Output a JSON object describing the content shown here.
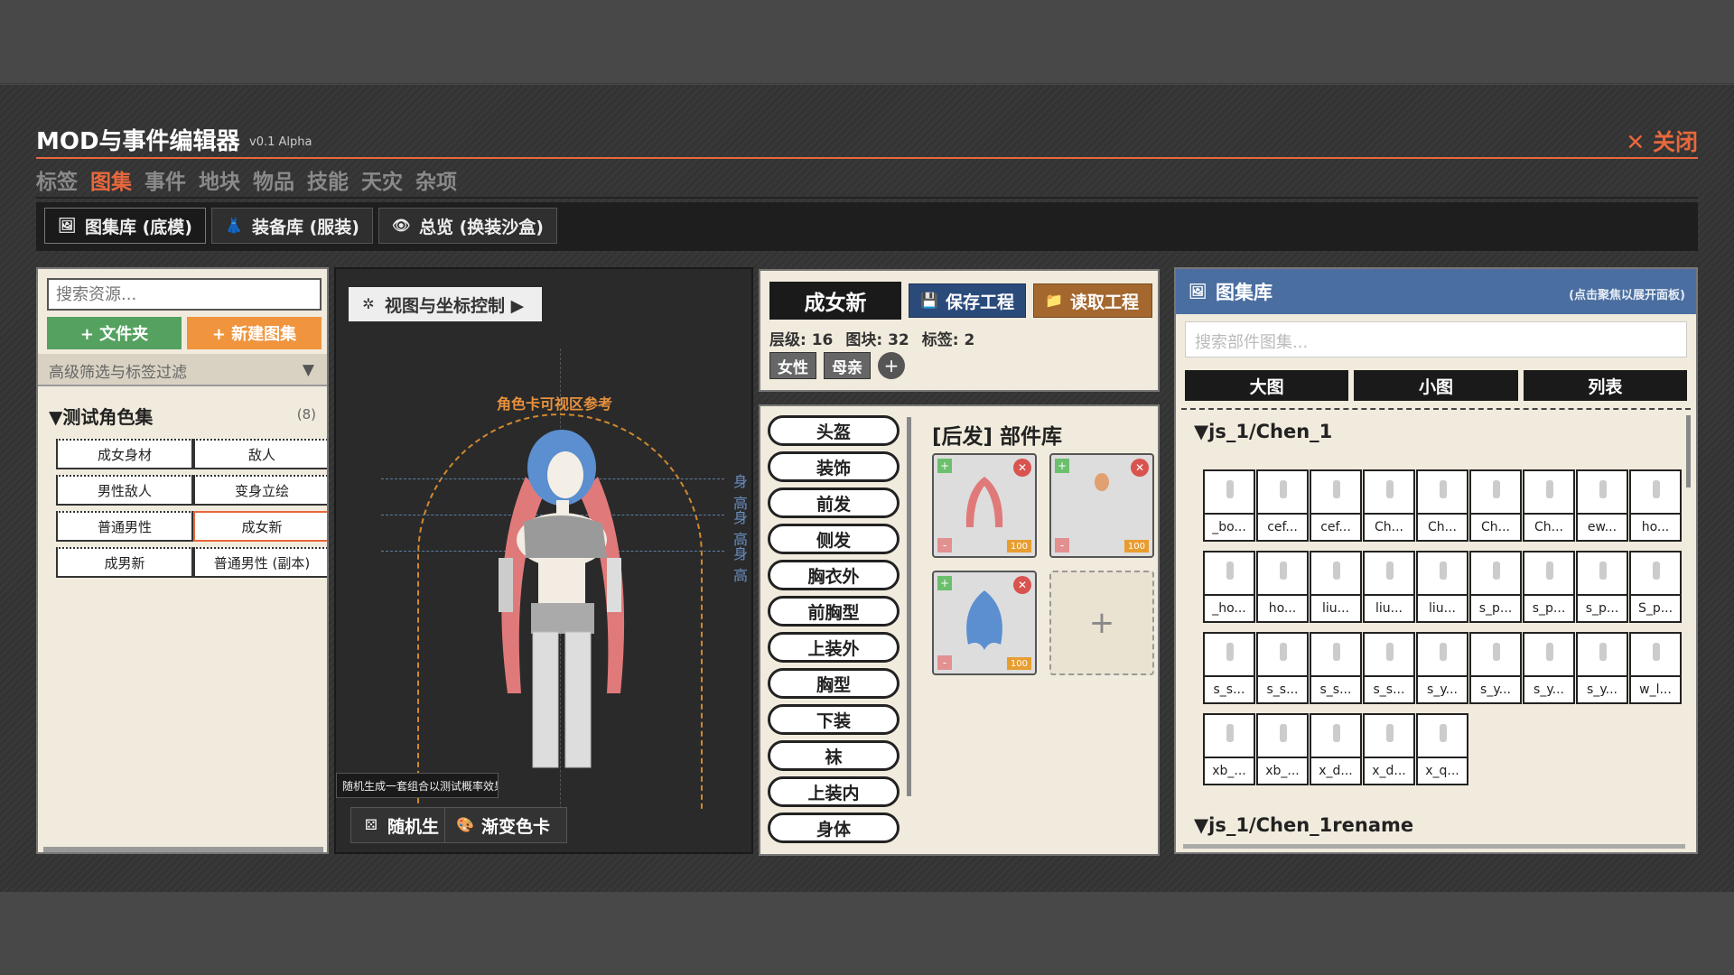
{
  "app": {
    "title": "MOD与事件编辑器",
    "version": "v0.1 Alpha",
    "close_label": "✕ 关闭"
  },
  "nav": [
    "标签",
    "图集",
    "事件",
    "地块",
    "物品",
    "技能",
    "天灾",
    "杂项"
  ],
  "subtabs": [
    {
      "label": "图集库 (底模)",
      "icon": "🖼"
    },
    {
      "label": "装备库 (服装)",
      "icon": "👗"
    },
    {
      "label": "总览 (换装沙盒)",
      "icon": "👁"
    }
  ],
  "left_panel": {
    "search_placeholder": "搜索资源...",
    "folder_btn": "+ 文件夹",
    "new_atlas_btn": "+ 新建图集",
    "filter_label": "高级筛选与标签过滤",
    "filter_arrow": "▼",
    "group_name": "▼测试角色集",
    "group_count": "(8)",
    "items": [
      "成女身材",
      "敌人",
      "男性敌人",
      "变身立绘",
      "普通男性",
      "成女新",
      "成男新",
      "普通男性 (副本)"
    ]
  },
  "viewport": {
    "view_btn": "视图与坐标控制 ▶",
    "ref_label": "角色卡可视区参考",
    "guide_label": "身高",
    "tooltip": "随机生成一套组合以测试概率效果",
    "random_btn": "随机生",
    "gradient_btn": "渐变色卡"
  },
  "project": {
    "name": "成女新",
    "save_btn": "保存工程",
    "load_btn": "读取工程",
    "stats": [
      "层级: 16",
      "图块: 32",
      "标签: 2"
    ],
    "tags": [
      "女性",
      "母亲"
    ],
    "add_tag": "+"
  },
  "parts": {
    "categories": [
      "头盔",
      "装饰",
      "前发",
      "侧发",
      "胸衣外",
      "前胸型",
      "上装外",
      "胸型",
      "下装",
      "袜",
      "上装内",
      "身体"
    ],
    "library_title": "[后发] 部件库",
    "badge": "100",
    "add_symbol": "+"
  },
  "atlas": {
    "title": "图集库",
    "hint": "(点击聚焦以展开面板)",
    "search_placeholder": "搜索部件图集...",
    "view_tabs": [
      "大图",
      "小图",
      "列表"
    ],
    "group1": "▼js_1/Chen_1",
    "group2": "▼js_1/Chen_1rename",
    "thumbs": [
      "_bo...",
      "cef...",
      "cef...",
      "Ch...",
      "Ch...",
      "Ch...",
      "Ch...",
      "ew...",
      "ho...",
      "_ho...",
      "ho...",
      "liu...",
      "liu...",
      "liu...",
      "s_p...",
      "s_p...",
      "s_p...",
      "S_p...",
      "s_s...",
      "s_s...",
      "s_s...",
      "s_s...",
      "s_y...",
      "s_y...",
      "s_y...",
      "s_y...",
      "w_l...",
      "xb_...",
      "xb_...",
      "x_d...",
      "x_d...",
      "x_q..."
    ]
  },
  "colors": {
    "accent": "#e8683d",
    "panel_bg": "#f1ebdd",
    "atlas_head": "#4a6ea0"
  }
}
